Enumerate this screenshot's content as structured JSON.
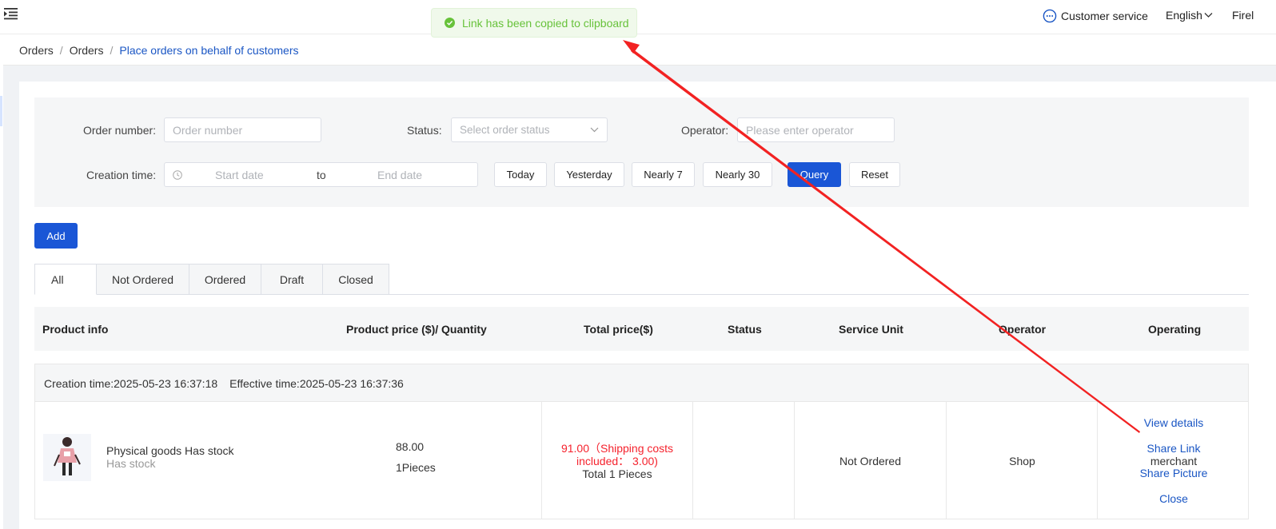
{
  "header": {
    "customer_service": "Customer service",
    "language": "English",
    "right_cut": "Firel"
  },
  "toast": {
    "message": "Link has been copied to clipboard",
    "color": "#67c23a"
  },
  "breadcrumb": {
    "items": [
      "Orders",
      "Orders",
      "Place orders on behalf of customers"
    ],
    "separator": "/"
  },
  "filters": {
    "order_number_label": "Order number:",
    "order_number_placeholder": "Order number",
    "status_label": "Status:",
    "status_placeholder": "Select order status",
    "operator_label": "Operator:",
    "operator_placeholder": "Please enter operator",
    "creation_time_label": "Creation time:",
    "start_date_placeholder": "Start date",
    "to": "to",
    "end_date_placeholder": "End date",
    "quick_buttons": [
      "Today",
      "Yesterday",
      "Nearly 7",
      "Nearly 30"
    ],
    "query": "Query",
    "reset": "Reset"
  },
  "add_button": "Add",
  "tabs": [
    "All",
    "Not Ordered",
    "Ordered",
    "Draft",
    "Closed"
  ],
  "columns": [
    "Product info",
    "Product price ($)/ Quantity",
    "Total price($)",
    "Status",
    "Service Unit",
    "Operator",
    "Operating"
  ],
  "order": {
    "creation_time": "Creation time:2025-05-23 16:37:18",
    "effective_time": "Effective time:2025-05-23 16:37:36",
    "product_name": "Physical goods Has stock",
    "product_sub": "Has stock",
    "price": "88.00",
    "quantity": "1Pieces",
    "total_line1": "91.00（Shipping costs",
    "total_line2": "included： 3.00)",
    "total_pieces": "Total 1 Pieces",
    "status": "Not Ordered",
    "service_unit": "Shop",
    "operator": "merchant",
    "actions": [
      "View details",
      "Share Link",
      "Share Picture",
      "Close"
    ]
  },
  "colors": {
    "primary": "#1a56d6",
    "link": "#1a56c4",
    "price_red": "#f5222d",
    "annotation_arrow": "#f22222"
  }
}
